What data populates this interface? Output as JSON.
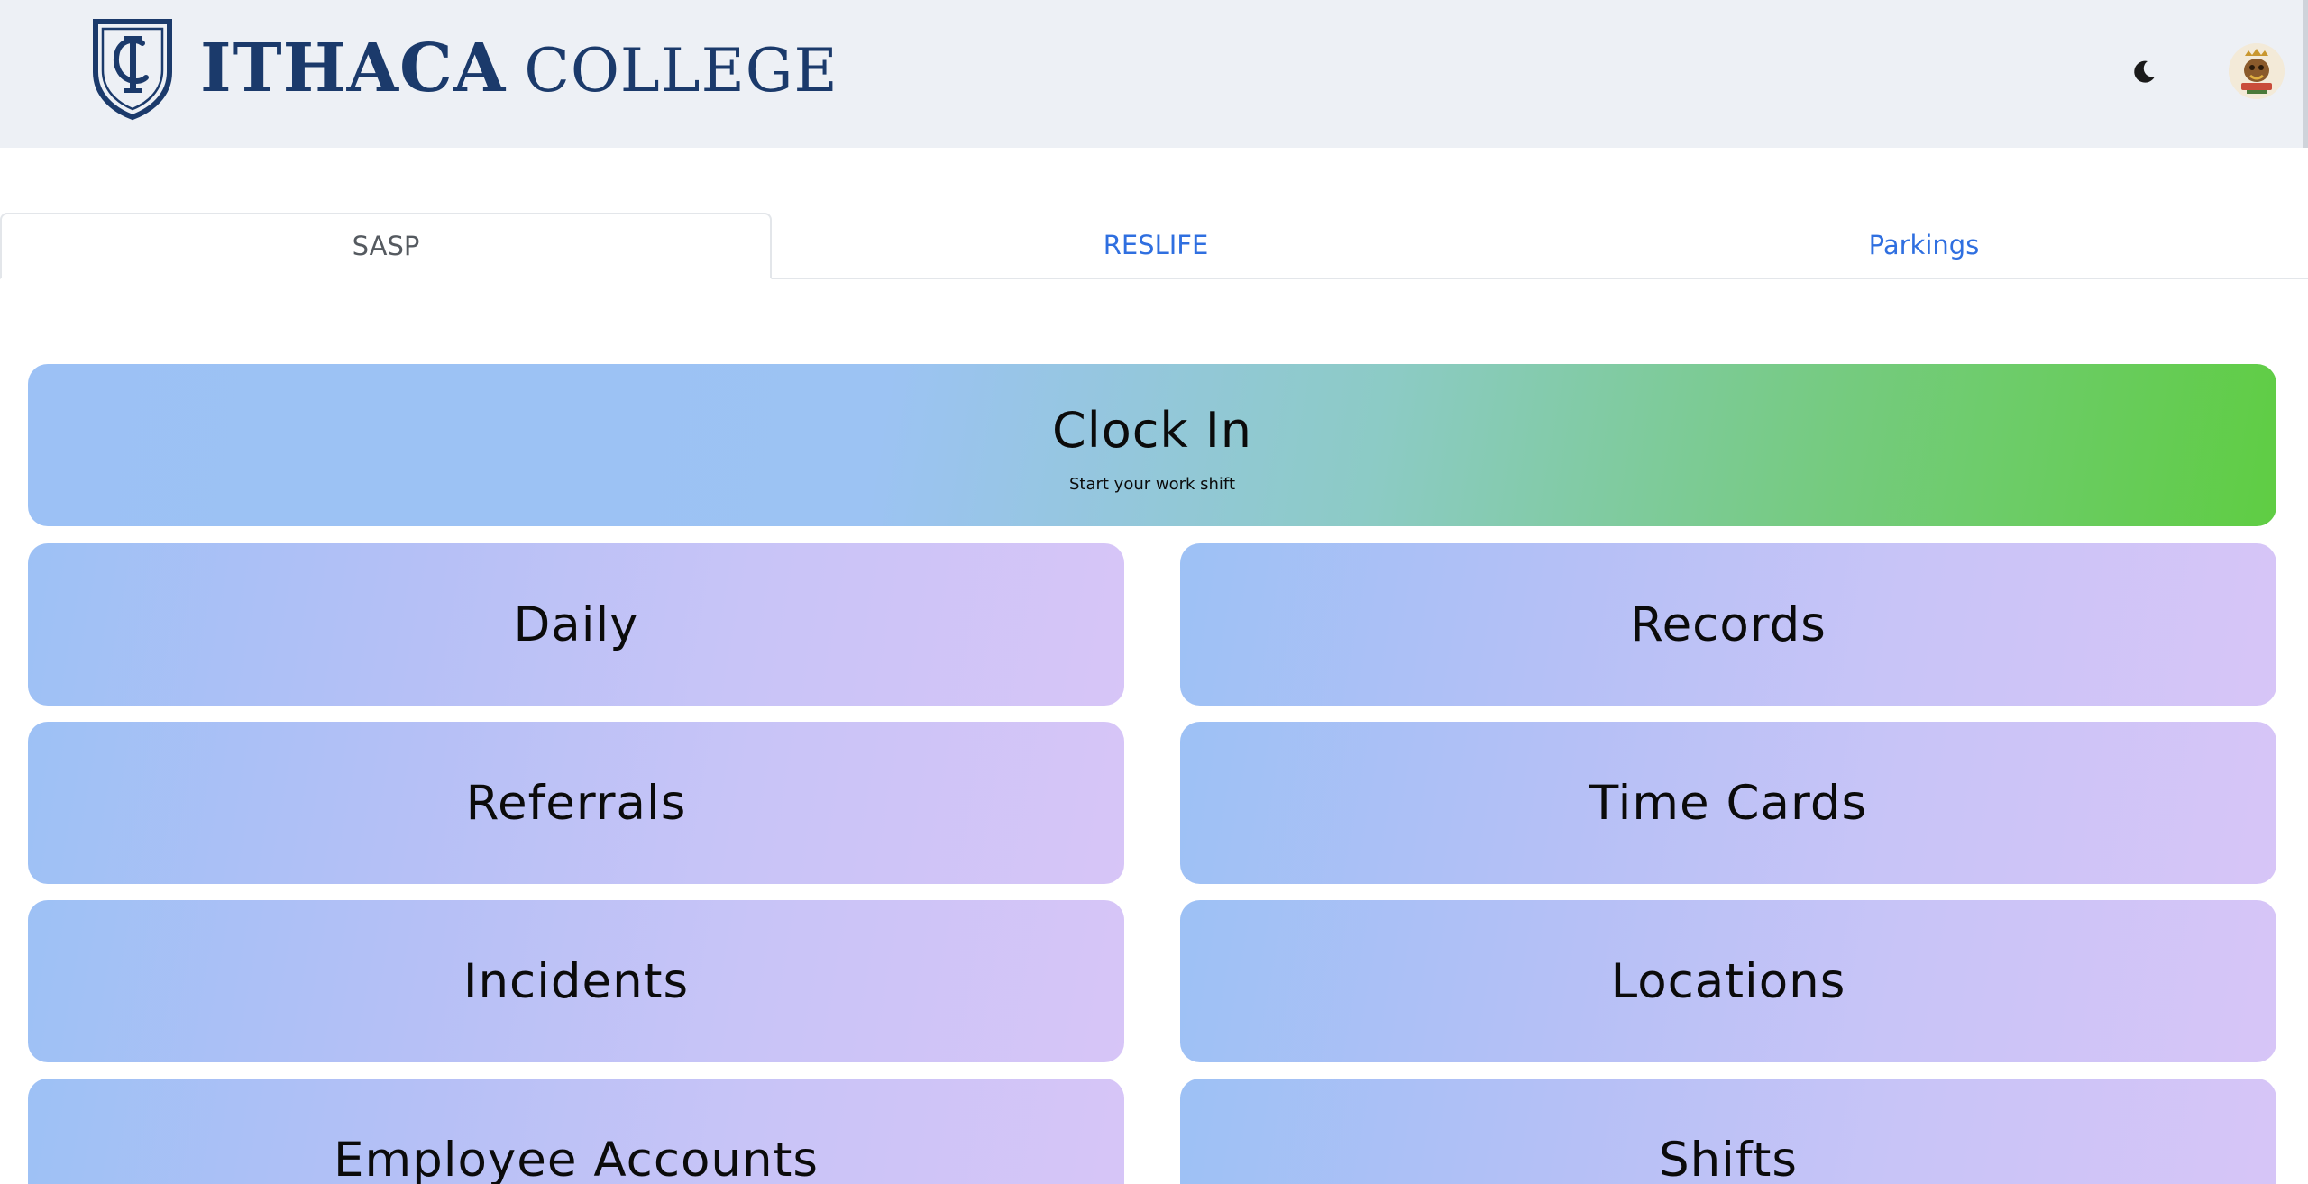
{
  "header": {
    "logo_word1": "ITHACA",
    "logo_word2": "COLLEGE",
    "logo_icon": "ic-crest-logo",
    "theme_icon": "moon-icon",
    "avatar_icon": "user-avatar"
  },
  "tabs": [
    {
      "label": "SASP",
      "active": true
    },
    {
      "label": "RESLIFE",
      "active": false
    },
    {
      "label": "Parkings",
      "active": false
    }
  ],
  "clock": {
    "label": "Clock In",
    "subtitle": "Start your work shift"
  },
  "tiles": [
    {
      "label": "Daily"
    },
    {
      "label": "Records"
    },
    {
      "label": "Referrals"
    },
    {
      "label": "Time Cards"
    },
    {
      "label": "Incidents"
    },
    {
      "label": "Locations"
    },
    {
      "label": "Employee Accounts"
    },
    {
      "label": "Shifts"
    }
  ],
  "colors": {
    "brand_navy": "#1b3a6b",
    "tab_link": "#2f6fe0",
    "clock_start": "#9cc1f5",
    "clock_end": "#5fcd43",
    "tile_start": "#9dc1f5",
    "tile_end": "#d7c5f7"
  }
}
